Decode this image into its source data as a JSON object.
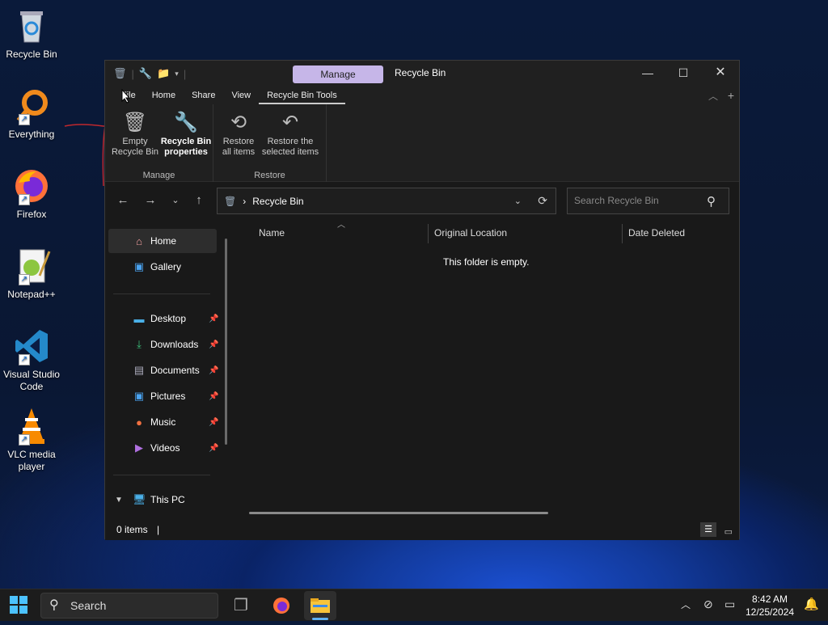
{
  "desktop": {
    "icons": [
      {
        "label": "Recycle Bin"
      },
      {
        "label": "Everything"
      },
      {
        "label": "Firefox"
      },
      {
        "label": "Notepad++"
      },
      {
        "label": "Visual Studio Code"
      },
      {
        "label": "VLC media player"
      }
    ]
  },
  "window": {
    "title": "Recycle Bin",
    "manage_tab": "Manage",
    "tabs": [
      "File",
      "Home",
      "Share",
      "View",
      "Recycle Bin Tools"
    ],
    "ribbon": {
      "empty_recycle_bin": "Empty Recycle Bin",
      "recycle_bin_properties": "Recycle Bin properties",
      "group_manage": "Manage",
      "restore_all": "Restore all items",
      "restore_selected": "Restore the selected items",
      "group_restore": "Restore"
    },
    "address": {
      "separator": "›",
      "path": "Recycle Bin"
    },
    "search": {
      "placeholder": "Search Recycle Bin"
    },
    "sidebar": {
      "items": [
        {
          "label": "Home"
        },
        {
          "label": "Gallery"
        },
        {
          "label": "Desktop"
        },
        {
          "label": "Downloads"
        },
        {
          "label": "Documents"
        },
        {
          "label": "Pictures"
        },
        {
          "label": "Music"
        },
        {
          "label": "Videos"
        },
        {
          "label": "This PC"
        }
      ]
    },
    "columns": [
      "Name",
      "Original Location",
      "Date Deleted"
    ],
    "empty_message": "This folder is empty.",
    "status": "0 items"
  },
  "taskbar": {
    "search_label": "Search",
    "time": "8:42 AM",
    "date": "12/25/2024"
  }
}
